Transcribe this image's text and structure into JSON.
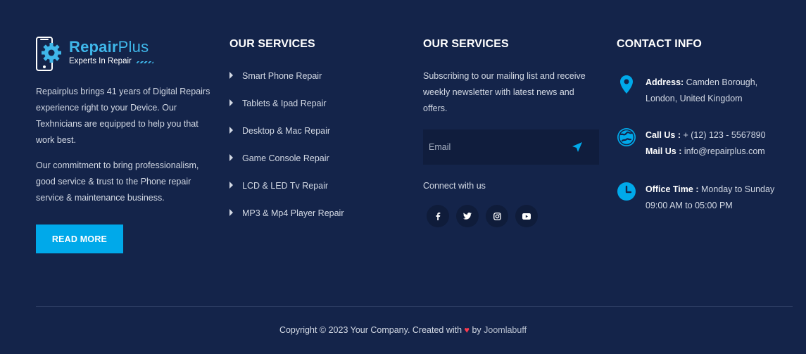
{
  "brand": {
    "name_bold": "Repair",
    "name_light": "Plus",
    "tagline": "Experts In Repair",
    "accent": "#3fb7ea",
    "logo_icon": "phone-gear-icon"
  },
  "about": {
    "paragraph1": "Repairplus brings 41 years of Digital Repairs experience right to your Device. Our Texhnicians are equipped to help you that work best.",
    "paragraph2": "Our commitment to bring professionalism, good service & trust to the Phone repair service & maintenance business.",
    "read_more_label": "READ MORE"
  },
  "services": {
    "title": "OUR SERVICES",
    "items": [
      "Smart Phone Repair",
      "Tablets & Ipad Repair",
      "Desktop & Mac Repair",
      "Game Console Repair",
      "LCD & LED Tv Repair",
      "MP3 & Mp4 Player Repair"
    ]
  },
  "newsletter": {
    "title": "OUR SERVICES",
    "text": "Subscribing to our mailing list and receive weekly newsletter with latest news and offers.",
    "email_placeholder": "Email",
    "connect_label": "Connect with us",
    "social": [
      {
        "icon": "facebook-icon",
        "glyph": "f"
      },
      {
        "icon": "twitter-icon",
        "glyph": "t"
      },
      {
        "icon": "instagram-icon",
        "glyph": "ig"
      },
      {
        "icon": "youtube-icon",
        "glyph": "yt"
      }
    ]
  },
  "contact": {
    "title": "CONTACT INFO",
    "address_label": "Address:",
    "address_line1": " Camden Borough,",
    "address_line2": "London, United Kingdom",
    "call_label": "Call Us :",
    "call_value": " + (12) 123 - 5567890",
    "mail_label": "Mail Us :",
    "mail_value": " info@repairplus.com",
    "office_label": "Office Time :",
    "office_line1": " Monday to Sunday",
    "office_line2": "09:00 AM to 05:00 PM",
    "icon_color": "#00a9ea"
  },
  "footer": {
    "copyright_prefix": "Copyright © 2023 Your Company. Created with",
    "heart": "♥",
    "by": "by",
    "company": "Joomlabuff"
  }
}
